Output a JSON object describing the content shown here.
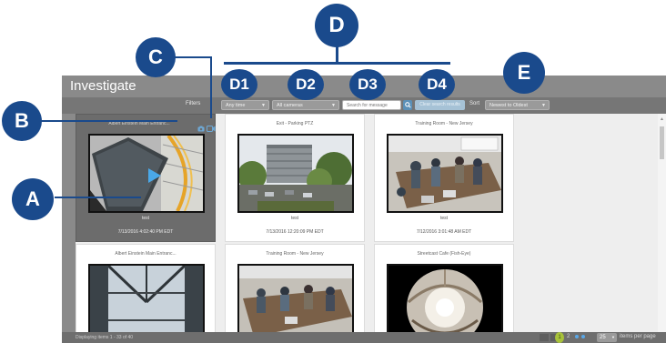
{
  "app": {
    "title": "Investigate"
  },
  "toolbar": {
    "filters_label": "Filters",
    "time_filter": "Any time",
    "camera_filter": "All cameras",
    "search_placeholder": "Search for message",
    "search_icon": "search-icon",
    "clear_button": "Clear search results",
    "sort_label": "Sort",
    "sort_value": "Newest to Oldest"
  },
  "cards": [
    {
      "title": "Albert Einstein Main Entranc...",
      "label": "test",
      "timestamp": "7/13/2016 4:02:40 PM EDT",
      "selected": true
    },
    {
      "title": "Exit - Parking PTZ",
      "label": "test",
      "timestamp": "7/13/2016 12:20:09 PM EDT",
      "selected": false
    },
    {
      "title": "Training Room - New Jersey",
      "label": "test",
      "timestamp": "7/12/2016 3:01:48 AM EDT",
      "selected": false
    },
    {
      "title": "Albert Einstein Main Entranc...",
      "label": "",
      "timestamp": "",
      "selected": false
    },
    {
      "title": "Training Room - New Jersey",
      "label": "",
      "timestamp": "",
      "selected": false
    },
    {
      "title": "Streetcast Cafe (Fish-Eye)",
      "label": "",
      "timestamp": "",
      "selected": false
    }
  ],
  "status": {
    "displaying": "Displaying items 1 - 33 of 40",
    "page_current": "1",
    "page_next": "2",
    "page_size": "25",
    "items_per_page": "items per page"
  },
  "annotations": {
    "A": "A",
    "B": "B",
    "C": "C",
    "D": "D",
    "D1": "D1",
    "D2": "D2",
    "D3": "D3",
    "D4": "D4",
    "E": "E"
  },
  "colors": {
    "accent": "#1a4a8c",
    "toolbar": "#767676",
    "header": "#8a8a8a",
    "search_button": "#5a90b8",
    "current_page": "#a8c23a"
  }
}
